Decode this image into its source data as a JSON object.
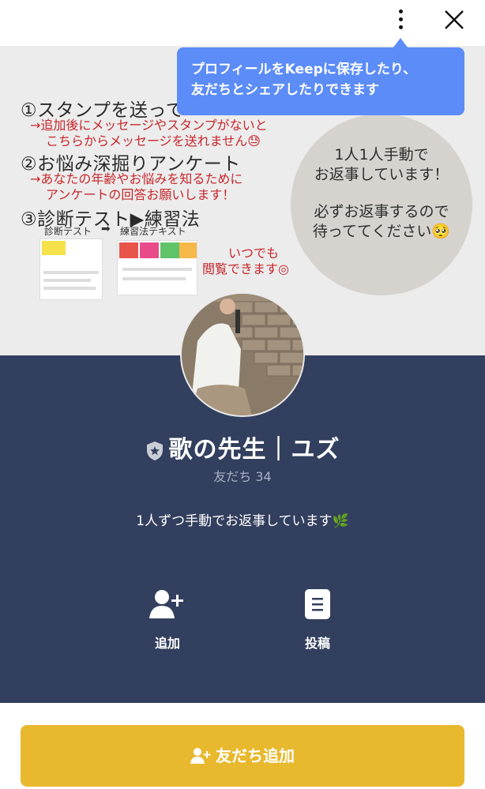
{
  "header": {
    "more_icon": "more-vertical-icon",
    "close_icon": "close-icon"
  },
  "tooltip": {
    "line1": "プロフィールをKeepに保存したり、",
    "line2": "友だちとシェアしたりできます"
  },
  "cover": {
    "step1": "①スタンプを送って",
    "step1_note1": "→追加後にメッセージやスタンプがないと",
    "step1_note2": "こちらからメッセージを送れません😓",
    "step2": "②お悩み深掘りアンケート",
    "step2_note1": "→あなたの年齢やお悩みを知るために",
    "step2_note2": "アンケートの回答お願いします！",
    "step3": "③診断テスト▶練習法",
    "step3_sub_a": "診断テスト",
    "step3_sub_b": "練習法テキスト",
    "anytime1": "いつでも",
    "anytime2": "閲覧できます◎",
    "circle_line1": "1人1人手動で",
    "circle_line2": "お返事しています！",
    "circle_line3": "必ずお返事するので",
    "circle_line4": "待っててください🥺"
  },
  "profile": {
    "name": "歌の先生｜ユズ",
    "friends_label": "友だち 34",
    "status_message": "1人ずつ手動でお返事しています🌿"
  },
  "actions": {
    "add_label": "追加",
    "post_label": "投稿"
  },
  "cta": {
    "label": "友だち追加",
    "color": "#e8b82e"
  },
  "colors": {
    "panel": "#323f5e",
    "tooltip": "#5b8cf7"
  }
}
